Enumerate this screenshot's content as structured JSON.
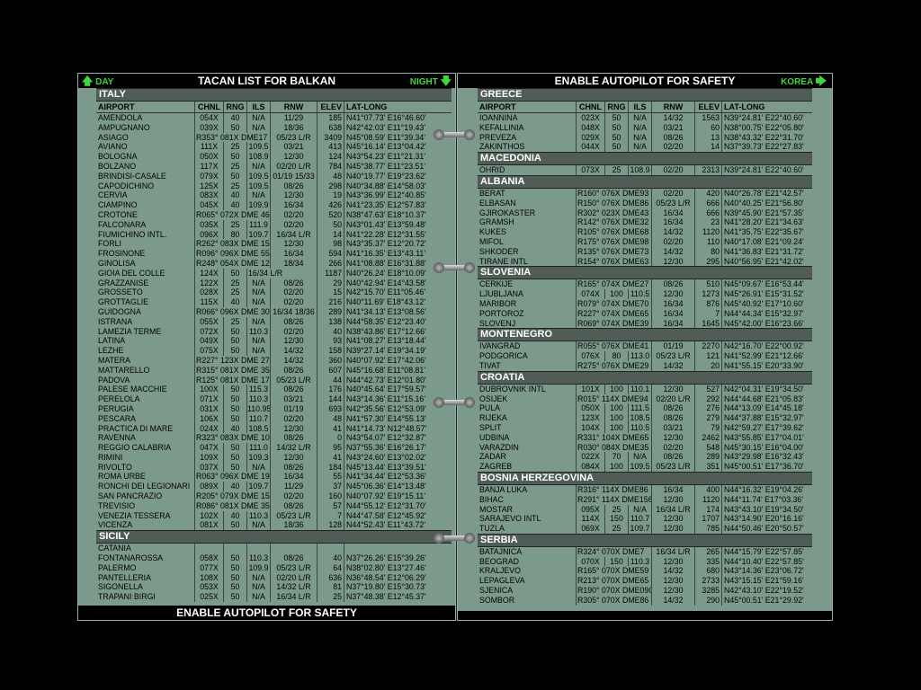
{
  "left": {
    "day_label": "DAY",
    "title": "TACAN LIST FOR BALKAN",
    "night_label": "NIGHT",
    "footer": "ENABLE AUTOPILOT FOR SAFETY",
    "columns": [
      "AIRPORT",
      "CHNL",
      "RNG",
      "ILS",
      "RNW",
      "ELEV",
      "LAT-LONG"
    ],
    "sections": [
      {
        "name": "ITALY",
        "rows": [
          [
            "AMENDOLA",
            "054X",
            "40",
            "N/A",
            "11/29",
            "185",
            "N41°07.73' E16°46.60'"
          ],
          [
            "AMPUGNANO",
            "039X",
            "50",
            "N/A",
            "18/36",
            "638",
            "N42°42.03' E11°19.43'"
          ],
          [
            "ASIAGO",
            "R353° 081X DME17",
            "",
            "",
            "05/23 L/R",
            "3409",
            "N45°08.59' E11°39.34'"
          ],
          [
            "AVIANO",
            "111X",
            "25",
            "109.5",
            "03/21",
            "413",
            "N45°16.14' E13°04.42'"
          ],
          [
            "BOLOGNA",
            "050X",
            "50",
            "108.9",
            "12/30",
            "124",
            "N43°54.23' E11°21.31'"
          ],
          [
            "BOLZANO",
            "117X",
            "25",
            "N/A",
            "02/20 L/R",
            "784",
            "N45°38.77' E11°23.51'"
          ],
          [
            "BRINDISI-CASALE",
            "079X",
            "50",
            "109.5",
            "01/19 15/33",
            "48",
            "N40°19.77' E19°23.62'"
          ],
          [
            "CAPODICHINO",
            "125X",
            "25",
            "109.5",
            "08/26",
            "298",
            "N40°34.88' E14°58.03'"
          ],
          [
            "CERVIA",
            "083X",
            "40",
            "N/A",
            "12/30",
            "19",
            "N43°36.99' E12°40.85'"
          ],
          [
            "CIAMPINO",
            "045X",
            "40",
            "109.9",
            "16/34",
            "426",
            "N41°23.35' E12°57.83'"
          ],
          [
            "CROTONE",
            "R065° 072X DME 46",
            "",
            "",
            "02/20",
            "520",
            "N38°47.63' E18°10.37'"
          ],
          [
            "FALCONARA",
            "035X",
            "25",
            "111.9",
            "02/20",
            "50",
            "N43°01.43' E13°59.48'"
          ],
          [
            "FIUMICHINO INTL.",
            "096X",
            "80",
            "109.7",
            "16/34 L/R",
            "14",
            "N41°22.28' E12°31.55'"
          ],
          [
            "FORLI",
            "R262° 083X DME 15",
            "",
            "",
            "12/30",
            "98",
            "N43°35.37' E12°20.72'"
          ],
          [
            "FROSINONE",
            "R096° 096X DME 55",
            "",
            "",
            "16/34",
            "594",
            "N41°16.35' E13°43.11'"
          ],
          [
            "GINOLISA",
            "R248° 054X DME 12",
            "",
            "",
            "18/34",
            "266",
            "N41°08.88' E16°31.88'"
          ],
          [
            "GIOIA DEL COLLE",
            "124X",
            "50",
            "16/34 L/R",
            "",
            "1187",
            "N40°26.24' E18°10.09'"
          ],
          [
            "GRAZZANISE",
            "122X",
            "25",
            "N/A",
            "08/26",
            "29",
            "N40°42.94' E14°43.58'"
          ],
          [
            "GROSSETO",
            "028X",
            "25",
            "N/A",
            "02/20",
            "15",
            "N42°15.70' E11°05.46'"
          ],
          [
            "GROTTAGLIE",
            "115X",
            "40",
            "N/A",
            "02/20",
            "216",
            "N40°11.69' E18°43.12'"
          ],
          [
            "GUIDOGNA",
            "R066° 096X DME 30",
            "",
            "",
            "16/34 18/36",
            "289",
            "N41°34.13' E13°08.56'"
          ],
          [
            "ISTRANA",
            "055X",
            "25",
            "N/A",
            "08/26",
            "138",
            "N44°58.35' E12°23.40'"
          ],
          [
            "LAMEZIA TERME",
            "072X",
            "50",
            "110.3",
            "02/20",
            "40",
            "N38°43.86' E17°12.66'"
          ],
          [
            "LATINA",
            "049X",
            "50",
            "N/A",
            "12/30",
            "93",
            "N41°08.27' E13°18.44'"
          ],
          [
            "LEZHE",
            "075X",
            "50",
            "N/A",
            "14/32",
            "158",
            "N39°27.14' E19°34.19'"
          ],
          [
            "MATERA",
            "R227° 123X DME 27",
            "",
            "",
            "14/32",
            "360",
            "N40°07.92' E17°42.06'"
          ],
          [
            "MATTARELLO",
            "R315° 081X DME 35",
            "",
            "",
            "08/26",
            "607",
            "N45°16.68' E11°08.81'"
          ],
          [
            "PADOVA",
            "R125° 081X DME 17",
            "",
            "",
            "05/23 L/R",
            "44",
            "N44°42.73' E12°01.80'"
          ],
          [
            "PALESE MACCHIE",
            "100X",
            "50",
            "115.3",
            "08/26",
            "176",
            "N40°45.64' E17°59.57'"
          ],
          [
            "PERELOLA",
            "071X",
            "50",
            "110.3",
            "03/21",
            "144",
            "N43°14.36' E11°15.16'"
          ],
          [
            "PERUGIA",
            "031X",
            "50",
            "110.95",
            "01/19",
            "693",
            "N42°35.56' E12°53.09'"
          ],
          [
            "PESCARA",
            "106X",
            "50",
            "110.7",
            "02/20",
            "48",
            "N41°57.30' E14°55.13'"
          ],
          [
            "PRACTICA DI MARE",
            "024X",
            "40",
            "108.5",
            "12/30",
            "41",
            "N41°14.73' N12°48.57'"
          ],
          [
            "RAVENNA",
            "R323° 083X DME 10",
            "",
            "",
            "08/26",
            "0",
            "N43°54.07' E12°32.87'"
          ],
          [
            "REGGIO CALABRIA",
            "047X",
            "50",
            "111.0",
            "14/32 L/R",
            "95",
            "N37°55.36' E16°26.17'"
          ],
          [
            "RIMINI",
            "109X",
            "50",
            "109.3",
            "12/30",
            "41",
            "N43°24.60' E13°02.02'"
          ],
          [
            "RIVOLTO",
            "037X",
            "50",
            "N/A",
            "08/26",
            "184",
            "N45°13.44' E13°39.51'"
          ],
          [
            "ROMA URBE",
            "R063° 096X DME 19",
            "",
            "",
            "16/34",
            "55",
            "N41°34.44' E12°53.36'"
          ],
          [
            "RONCHI DEI LEGIONARI",
            "089X",
            "40",
            "109.7",
            "11/29",
            "37",
            "N45°06.36' E14°13.48'"
          ],
          [
            "SAN PANCRAZIO",
            "R205° 079X DME 15",
            "",
            "",
            "02/20",
            "160",
            "N40°07.92' E19°15.11'"
          ],
          [
            "TREVISIO",
            "R086° 081X DME 35",
            "",
            "",
            "08/26",
            "57",
            "N44°55.12' E12°31.70'"
          ],
          [
            "VENEZIA TESSERA",
            "102X",
            "40",
            "110.3",
            "05/23 L/R",
            "7",
            "N44°47.58' E12°45.92'"
          ],
          [
            "VICENZA",
            "081X",
            "50",
            "N/A",
            "18/36",
            "128",
            "N44°52.43' E11°43.72'"
          ]
        ]
      },
      {
        "name": "SICILY",
        "rows": [
          [
            "CATANIA",
            "",
            "",
            "",
            "",
            "",
            ""
          ],
          [
            "FONTANAROSSA",
            "058X",
            "50",
            "110.3",
            "08/26",
            "40",
            "N37°26.26' E15°39.26'"
          ],
          [
            "PALERMO",
            "077X",
            "50",
            "109.9",
            "05/23 L/R",
            "64",
            "N38°02.80' E13°27.46'"
          ],
          [
            "PANTELLERIA",
            "108X",
            "50",
            "N/A",
            "02/20 L/R",
            "636",
            "N36°48.54' E12°06.29'"
          ],
          [
            "SIGONELLA",
            "053X",
            "50",
            "N/A",
            "14/32 L/R",
            "81",
            "N37°19.80' E15°30.73'"
          ],
          [
            "TRAPANI BIRGI",
            "025X",
            "50",
            "N/A",
            "16/34 L/R",
            "25",
            "N37°48.38' E12°45.37'"
          ]
        ]
      }
    ]
  },
  "right": {
    "title": "ENABLE AUTOPILOT FOR SAFETY",
    "korea_label": "KOREA",
    "columns": [
      "AIRPORT",
      "CHNL",
      "RNG",
      "ILS",
      "RNW",
      "ELEV",
      "LAT-LONG"
    ],
    "sections": [
      {
        "name": "GREECE",
        "rows": [
          [
            "IOANNINA",
            "023X",
            "50",
            "N/A",
            "14/32",
            "1563",
            "N39°24.81' E22°40.60'"
          ],
          [
            "KEFALLINIA",
            "048X",
            "50",
            "N/A",
            "03/21",
            "60",
            "N38°00.75' E22°05.80'"
          ],
          [
            "PREVEZA",
            "029X",
            "50",
            "N/A",
            "08/26",
            "13",
            "N38°43.32' E22°31.70'"
          ],
          [
            "ZAKINTHOS",
            "044X",
            "50",
            "N/A",
            "02/20",
            "14",
            "N37°39.73' E22°27.83'"
          ]
        ]
      },
      {
        "name": "MACEDONIA",
        "rows": [
          [
            "OHRID",
            "073X",
            "25",
            "108.9",
            "02/20",
            "2313",
            "N39°24.81' E22°40.60'"
          ]
        ]
      },
      {
        "name": "ALBANIA",
        "rows": [
          [
            "BERAT",
            "R160° 076X DME93",
            "",
            "",
            "02/20",
            "420",
            "N40°26.78' E21°42.57'"
          ],
          [
            "ELBASAN",
            "R150° 076X DME86",
            "",
            "",
            "05/23 L/R",
            "666",
            "N40°40.25' E21°56.80'"
          ],
          [
            "GJIROKASTER",
            "R302° 023X DME43",
            "",
            "",
            "16/34",
            "666",
            "N39°45.90' E21°57.35'"
          ],
          [
            "GRAMSH",
            "R142° 076X DME32",
            "",
            "",
            "16/34",
            "23",
            "N41°28.20' E21°34.63'"
          ],
          [
            "KUKES",
            "R105° 076X DME68",
            "",
            "",
            "14/32",
            "1120",
            "N41°35.75' E22°35.67'"
          ],
          [
            "MIFOL",
            "R175° 076X DME98",
            "",
            "",
            "02/20",
            "110",
            "N40°17.08' E21°09.24'"
          ],
          [
            "SHKODER",
            "R135° 076X DME73",
            "",
            "",
            "14/32",
            "80",
            "N41°36.83' E21°31.72'"
          ],
          [
            "TIRANE INTL",
            "R154° 076X DME63",
            "",
            "",
            "12/30",
            "295",
            "N40°56.95' E21°42.02'"
          ]
        ]
      },
      {
        "name": "SLOVENIA",
        "rows": [
          [
            "CERKIJE",
            "R165° 074X DME27",
            "",
            "",
            "08/26",
            "510",
            "N45°09.67' E16°53.44'"
          ],
          [
            "LJUBLJANA",
            "074X",
            "100",
            "110.5",
            "12/30",
            "1273",
            "N45°26.91' E15°31.52'"
          ],
          [
            "MARIBOR",
            "R079° 074X DME70",
            "",
            "",
            "16/34",
            "876",
            "N45°40.92' E17°10.60'"
          ],
          [
            "PORTOROZ",
            "R227° 074X DME65",
            "",
            "",
            "16/34",
            "7",
            "N44°44.34' E15°32.97'"
          ],
          [
            "SLOVENJ",
            "R069° 074X DME39",
            "",
            "",
            "16/34",
            "1645",
            "N45°42.00' E16°23.66'"
          ]
        ]
      },
      {
        "name": "MONTENEGRO",
        "rows": [
          [
            "IVANGRAD",
            "R055° 076X DME41",
            "",
            "",
            "01/19",
            "2270",
            "N42°16.70' E22°00.92'"
          ],
          [
            "PODGORICA",
            "076X",
            "80",
            "113.0",
            "05/23 L/R",
            "121",
            "N41°52.99' E21°12.66'"
          ],
          [
            "TIVAT",
            "R275° 076X DME29",
            "",
            "",
            "14/32",
            "20",
            "N41°55.15' E20°33.90'"
          ]
        ]
      },
      {
        "name": "CROATIA",
        "rows": [
          [
            "DUBROVNIK INTL",
            "101X",
            "100",
            "110.1",
            "12/30",
            "527",
            "N42°04.31' E19°34.50'"
          ],
          [
            "OSIJEK",
            "R015° 114X DME94",
            "",
            "",
            "02/20 L/R",
            "292",
            "N44°44.68' E21°05.83'"
          ],
          [
            "PULA",
            "050X",
            "100",
            "111.5",
            "08/26",
            "276",
            "N44°13.09' E14°45.18'"
          ],
          [
            "RIJEKA",
            "123X",
            "100",
            "108.5",
            "08/26",
            "279",
            "N44°37.88' E15°32.97'"
          ],
          [
            "SPLIT",
            "104X",
            "100",
            "110.5",
            "03/21",
            "79",
            "N42°59.27' E17°39.62'"
          ],
          [
            "UDBINA",
            "R331° 104X DME65",
            "",
            "",
            "12/30",
            "2462",
            "N43°55.85' E17°04.01'"
          ],
          [
            "VARAZDIN",
            "R030° 084X DME35",
            "",
            "",
            "02/20",
            "548",
            "N45°30.15' E16°04.00'"
          ],
          [
            "ZADAR",
            "022X",
            "70",
            "N/A",
            "08/26",
            "289",
            "N43°29.98' E16°32.43'"
          ],
          [
            "ZAGREB",
            "084X",
            "100",
            "109.5",
            "05/23 L/R",
            "351",
            "N45°00.51' E17°36.70'"
          ]
        ]
      },
      {
        "name": "BOSNIA HERZEGOVINA",
        "rows": [
          [
            "BANJA LUKA",
            "R316° 114X DME86",
            "",
            "",
            "16/34",
            "400",
            "N44°16.32' E19°04.26'"
          ],
          [
            "BIHAC",
            "R291° 114X DME156",
            "",
            "",
            "12/30",
            "1120",
            "N44°11.74' E17°03.36'"
          ],
          [
            "MOSTAR",
            "095X",
            "25",
            "N/A",
            "16/34 L/R",
            "174",
            "N43°43.10' E19°34.50'"
          ],
          [
            "SARAJEVO INTL",
            "114X",
            "150",
            "110.7",
            "12/30",
            "1707",
            "N43°14.90' E20°16.16'"
          ],
          [
            "TUZLA",
            "069X",
            "25",
            "109.7",
            "12/30",
            "785",
            "N44°50.46' E20°50.57'"
          ]
        ]
      },
      {
        "name": "SERBIA",
        "rows": [
          [
            "BATAJNICA",
            "R324° 070X DME7",
            "",
            "",
            "16/34 L/R",
            "265",
            "N44°15.79' E22°57.85'"
          ],
          [
            "BEOGRAD",
            "070X",
            "150",
            "110.3",
            "12/30",
            "335",
            "N44°10.40' E22°57.85'"
          ],
          [
            "KRALJEVO",
            "R165° 070X DME59",
            "",
            "",
            "14/32",
            "680",
            "N43°14.36' E23°06.72'"
          ],
          [
            "LEPAGLEVA",
            "R213° 070X DME65",
            "",
            "",
            "12/30",
            "2733",
            "N43°15.15' E21°59.16'"
          ],
          [
            "SJENICA",
            "R190° 070X DME090",
            "",
            "",
            "12/30",
            "3285",
            "N42°43.10' E22°19.52'"
          ],
          [
            "SOMBOR",
            "R305° 070X DME86",
            "",
            "",
            "14/32",
            "290",
            "N45°00.51' E21°29.92'"
          ]
        ]
      }
    ]
  }
}
